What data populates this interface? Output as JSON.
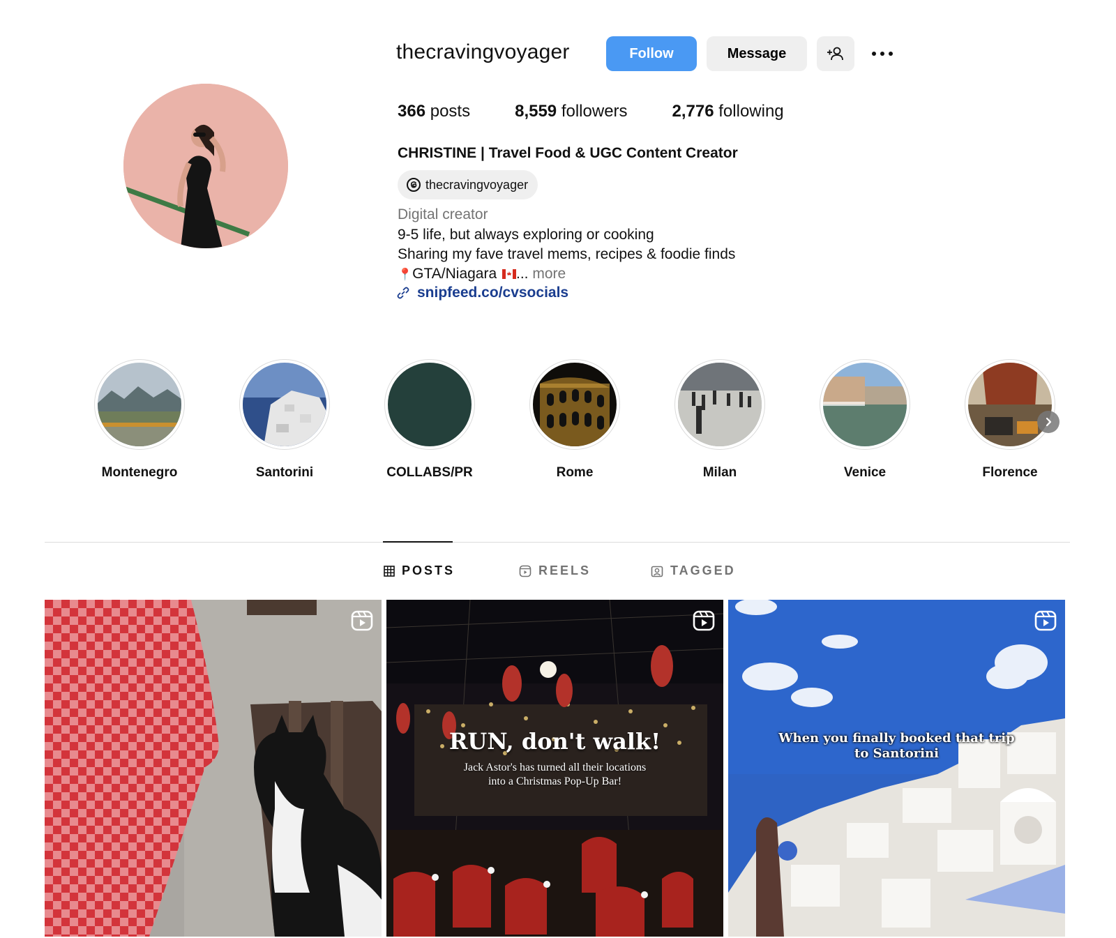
{
  "profile": {
    "username": "thecravingvoyager",
    "follow_label": "Follow",
    "message_label": "Message",
    "stats": {
      "posts_count": "366",
      "posts_label": "posts",
      "followers_count": "8,559",
      "followers_label": "followers",
      "following_count": "2,776",
      "following_label": "following"
    },
    "full_name": "CHRISTINE | Travel Food & UGC Content Creator",
    "threads_handle": "thecravingvoyager",
    "category": "Digital creator",
    "bio_line1": "9-5 life, but always exploring or cooking",
    "bio_line2": "Sharing my fave travel mems, recipes & foodie finds",
    "bio_line3_pin": "📍",
    "bio_line3_text": "GTA/Niagara",
    "bio_line3_ellipsis": "...",
    "bio_more": "more",
    "link": "snipfeed.co/cvsocials"
  },
  "highlights": [
    {
      "label": "Montenegro"
    },
    {
      "label": "Santorini"
    },
    {
      "label": "COLLABS/PR"
    },
    {
      "label": "Rome"
    },
    {
      "label": "Milan"
    },
    {
      "label": "Venice"
    },
    {
      "label": "Florence"
    }
  ],
  "tabs": {
    "posts": "POSTS",
    "reels": "REELS",
    "tagged": "TAGGED",
    "active": "posts"
  },
  "posts": [
    {
      "type": "reel",
      "description": "cat on bench next to checkered tablecloth"
    },
    {
      "type": "reel",
      "overlay_title": "RUN, don't walk!",
      "overlay_line1": "Jack Astor's has turned all their locations",
      "overlay_line2": "into a Christmas Pop-Up Bar!"
    },
    {
      "type": "reel",
      "overlay_line1": "When you finally booked that trip",
      "overlay_line2": "to Santorini"
    }
  ],
  "colors": {
    "follow_button": "#4a99f3",
    "secondary_button": "#efefef",
    "link": "#1a3d8f",
    "muted_text": "#737373",
    "divider": "#dbdbdb"
  },
  "icons": [
    "add-user-icon",
    "more-icon",
    "threads-icon",
    "link-icon",
    "grid-icon",
    "reels-icon",
    "tagged-icon",
    "reel-badge-icon",
    "chevron-right-icon"
  ]
}
